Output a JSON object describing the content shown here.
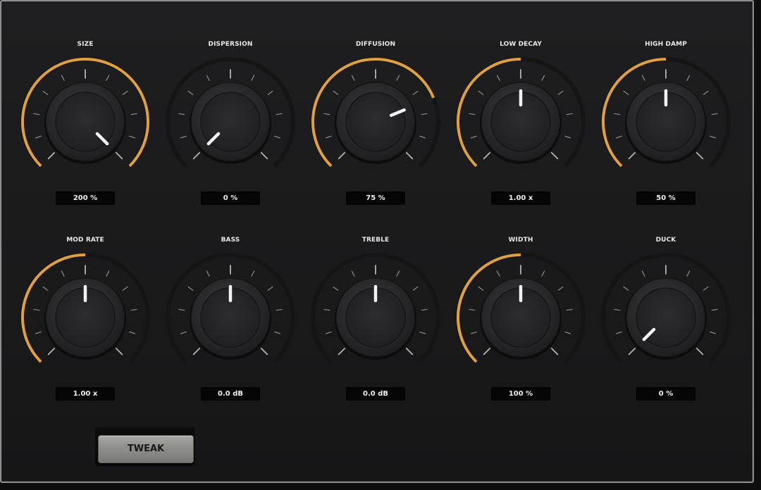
{
  "colors": {
    "accent_arc": "#e0a040",
    "track": "#151515",
    "tick": "#bdbdbd",
    "indicator": "#f2f2f2"
  },
  "knobs": [
    {
      "id": "size",
      "label": "SIZE",
      "value": "200 %",
      "fraction": 1.0
    },
    {
      "id": "dispersion",
      "label": "DISPERSION",
      "value": "0 %",
      "fraction": 0.0
    },
    {
      "id": "diffusion",
      "label": "DIFFUSION",
      "value": "75 %",
      "fraction": 0.75
    },
    {
      "id": "low-decay",
      "label": "LOW DECAY",
      "value": "1.00 x",
      "fraction": 0.5
    },
    {
      "id": "high-damp",
      "label": "HIGH DAMP",
      "value": "50 %",
      "fraction": 0.5
    },
    {
      "id": "mod-rate",
      "label": "MOD RATE",
      "value": "1.00 x",
      "fraction": 0.5
    },
    {
      "id": "bass",
      "label": "BASS",
      "value": "0.0 dB",
      "fraction": 0.5
    },
    {
      "id": "treble",
      "label": "TREBLE",
      "value": "0.0 dB",
      "fraction": 0.5
    },
    {
      "id": "width",
      "label": "WIDTH",
      "value": "100 %",
      "fraction": 0.5
    },
    {
      "id": "duck",
      "label": "DUCK",
      "value": "0 %",
      "fraction": 0.0
    }
  ],
  "knob_arc": [
    "show",
    "hide",
    "show",
    "show",
    "show",
    "show",
    "hide",
    "hide",
    "show",
    "hide"
  ],
  "tweak_button": {
    "label": "TWEAK"
  }
}
